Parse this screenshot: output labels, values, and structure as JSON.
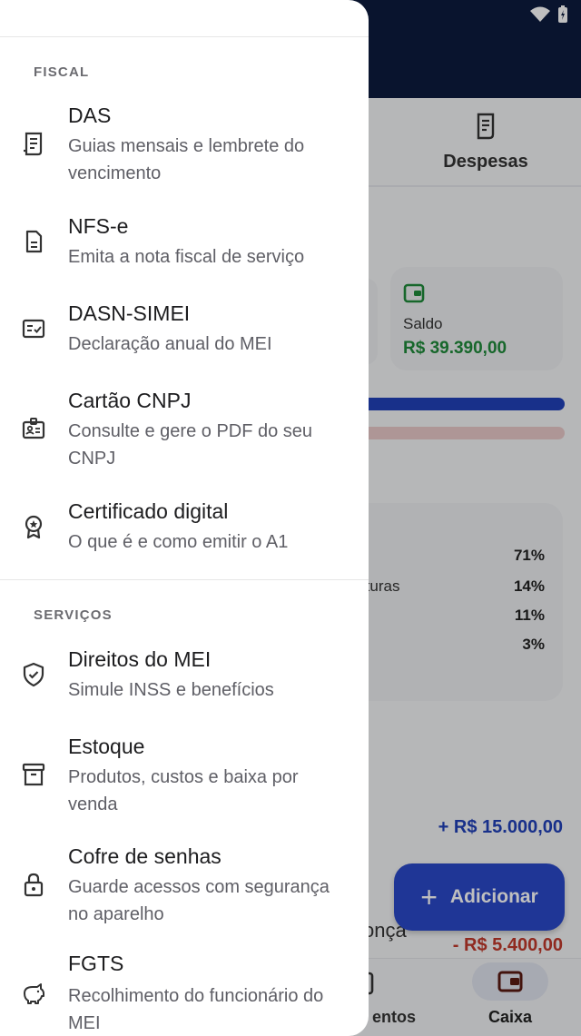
{
  "background": {
    "tab_despesas": "Despesas",
    "saldo_label": "Saldo",
    "saldo_value": "R$ 39.390,00",
    "breakdown": [
      {
        "label": "",
        "pct": "71%"
      },
      {
        "label": "inaturas",
        "pct": "14%"
      },
      {
        "label": "",
        "pct": "11%"
      },
      {
        "label": "",
        "pct": "3%"
      }
    ],
    "income_value": "+ R$ 15.000,00",
    "fragment_label": "onça",
    "expense_value": "- R$ 5.400,00",
    "fab_label": "Adicionar",
    "nav_fragment": "entos",
    "nav_caixa": "Caixa",
    "accent": "#2a48c8"
  },
  "drawer": {
    "sections": [
      {
        "title": "FISCAL",
        "items": [
          {
            "title": "DAS",
            "subtitle": "Guias mensais e lembrete do vencimento",
            "icon": "receipt-icon"
          },
          {
            "title": "NFS-e",
            "subtitle": "Emita a nota fiscal de serviço",
            "icon": "document-icon"
          },
          {
            "title": "DASN-SIMEI",
            "subtitle": "Declaração anual do MEI",
            "icon": "checklist-icon"
          },
          {
            "title": "Cartão CNPJ",
            "subtitle": "Consulte e gere o PDF do seu CNPJ",
            "icon": "id-badge-icon"
          },
          {
            "title": "Certificado digital",
            "subtitle": "O que é e como emitir o A1",
            "icon": "award-icon"
          }
        ]
      },
      {
        "title": "SERVIÇOS",
        "items": [
          {
            "title": "Direitos do MEI",
            "subtitle": "Simule INSS e benefícios",
            "icon": "shield-check-icon"
          },
          {
            "title": "Estoque",
            "subtitle": "Produtos, custos e baixa por venda",
            "icon": "archive-box-icon"
          },
          {
            "title": "Cofre de senhas",
            "subtitle": "Guarde acessos com segurança no aparelho",
            "icon": "lock-icon"
          },
          {
            "title": "FGTS",
            "subtitle": "Recolhimento do funcionário do MEI",
            "icon": "piggy-bank-icon"
          }
        ]
      }
    ]
  }
}
